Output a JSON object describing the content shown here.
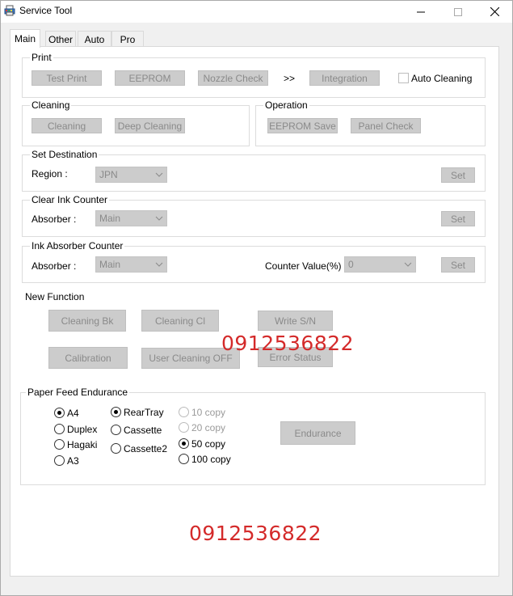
{
  "window": {
    "title": "Service Tool",
    "icons": {
      "app": "printer-app-icon",
      "minimize": "minimize-icon",
      "maximize": "maximize-icon",
      "close": "close-icon"
    }
  },
  "tabs": [
    {
      "label": "Main",
      "active": true
    },
    {
      "label": "Other",
      "active": false
    },
    {
      "label": "Auto",
      "active": false
    },
    {
      "label": "Pro",
      "active": false
    }
  ],
  "print": {
    "legend": "Print",
    "test_print": "Test Print",
    "eeprom": "EEPROM",
    "nozzle_check": "Nozzle Check",
    "arrow": ">>",
    "integration": "Integration",
    "auto_cleaning": "Auto Cleaning"
  },
  "cleaning": {
    "legend": "Cleaning",
    "cleaning": "Cleaning",
    "deep_cleaning": "Deep Cleaning"
  },
  "operation": {
    "legend": "Operation",
    "eeprom_save": "EEPROM Save",
    "panel_check": "Panel Check"
  },
  "set_destination": {
    "legend": "Set Destination",
    "region_label": "Region :",
    "region_value": "JPN",
    "set": "Set"
  },
  "clear_ink_counter": {
    "legend": "Clear Ink Counter",
    "absorber_label": "Absorber :",
    "absorber_value": "Main",
    "set": "Set"
  },
  "ink_absorber_counter": {
    "legend": "Ink Absorber Counter",
    "absorber_label": "Absorber :",
    "absorber_value": "Main",
    "counter_label": "Counter Value(%) :",
    "counter_value": "0",
    "set": "Set"
  },
  "new_function": {
    "heading": "New Function",
    "cleaning_bk": "Cleaning Bk",
    "cleaning_cl": "Cleaning Cl",
    "write_sn": "Write S/N",
    "calibration": "Calibration",
    "user_cleaning_off": "User Cleaning OFF",
    "error_status": "Error Status"
  },
  "paper_feed": {
    "legend": "Paper Feed Endurance",
    "paper_sizes": [
      {
        "label": "A4",
        "checked": true
      },
      {
        "label": "Duplex",
        "checked": false
      },
      {
        "label": "Hagaki",
        "checked": false
      },
      {
        "label": "A3",
        "checked": false
      }
    ],
    "trays": [
      {
        "label": "RearTray",
        "checked": true
      },
      {
        "label": "Cassette",
        "checked": false
      },
      {
        "label": "Cassette2",
        "checked": false
      }
    ],
    "copies": [
      {
        "label": "10 copy",
        "checked": false,
        "enabled": false
      },
      {
        "label": "20 copy",
        "checked": false,
        "enabled": false
      },
      {
        "label": "50 copy",
        "checked": true,
        "enabled": true
      },
      {
        "label": "100 copy",
        "checked": false,
        "enabled": true
      }
    ],
    "endurance": "Endurance"
  },
  "watermarks": [
    "0912536822",
    "0912536822"
  ],
  "colors": {
    "watermark": "#d42a2a",
    "disabled_button": "#cccccc",
    "disabled_text": "#8a8a8a"
  }
}
